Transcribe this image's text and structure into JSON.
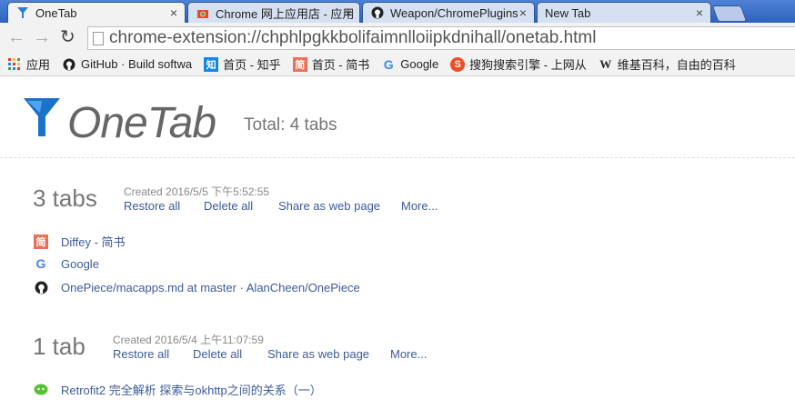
{
  "tabs": [
    {
      "label": "OneTab",
      "active": true
    },
    {
      "label": "Chrome 网上应用店 - 应用"
    },
    {
      "label": "Weapon/ChromePlugins"
    },
    {
      "label": "New Tab"
    }
  ],
  "tab_close": "×",
  "address": "chrome-extension://chphlpgkkbolifaimnlloiipkdnihall/onetab.html",
  "bookmarks": [
    {
      "label": "应用",
      "icon": "apps-icon"
    },
    {
      "label": "GitHub · Build softwa",
      "icon": "github-icon"
    },
    {
      "label": "首页 - 知乎",
      "icon": "zhihu-icon",
      "glyph": "知"
    },
    {
      "label": "首页 - 简书",
      "icon": "jianshu-icon",
      "glyph": "简"
    },
    {
      "label": "Google",
      "icon": "google-icon",
      "glyph": "G"
    },
    {
      "label": "搜狗搜索引擎 - 上网从",
      "icon": "sogou-icon",
      "glyph": "S"
    },
    {
      "label": "维基百科，自由的百科",
      "icon": "wikipedia-icon",
      "glyph": "W"
    }
  ],
  "brand": "OneTab",
  "total": "Total: 4 tabs",
  "groups": [
    {
      "count": "3 tabs",
      "created": "Created 2016/5/5 下午5:52:55",
      "actions": {
        "restore": "Restore all",
        "delete": "Delete all",
        "share": "Share as web page",
        "more": "More..."
      },
      "items": [
        {
          "title": "Diffey - 简书",
          "icon": "jianshu-icon"
        },
        {
          "title": "Google",
          "icon": "google-icon"
        },
        {
          "title": "OnePiece/macapps.md at master · AlanCheen/OnePiece",
          "icon": "github-icon"
        }
      ]
    },
    {
      "count": "1 tab",
      "created": "Created 2016/5/4 上午11:07:59",
      "actions": {
        "restore": "Restore all",
        "delete": "Delete all",
        "share": "Share as web page",
        "more": "More..."
      },
      "items": [
        {
          "title": "Retrofit2 完全解析 探索与okhttp之间的关系（一）",
          "icon": "wechat-icon"
        }
      ]
    }
  ],
  "colors": {
    "link": "#3c5b9b",
    "tabstrip": "#2d63be",
    "muted": "#777777"
  }
}
